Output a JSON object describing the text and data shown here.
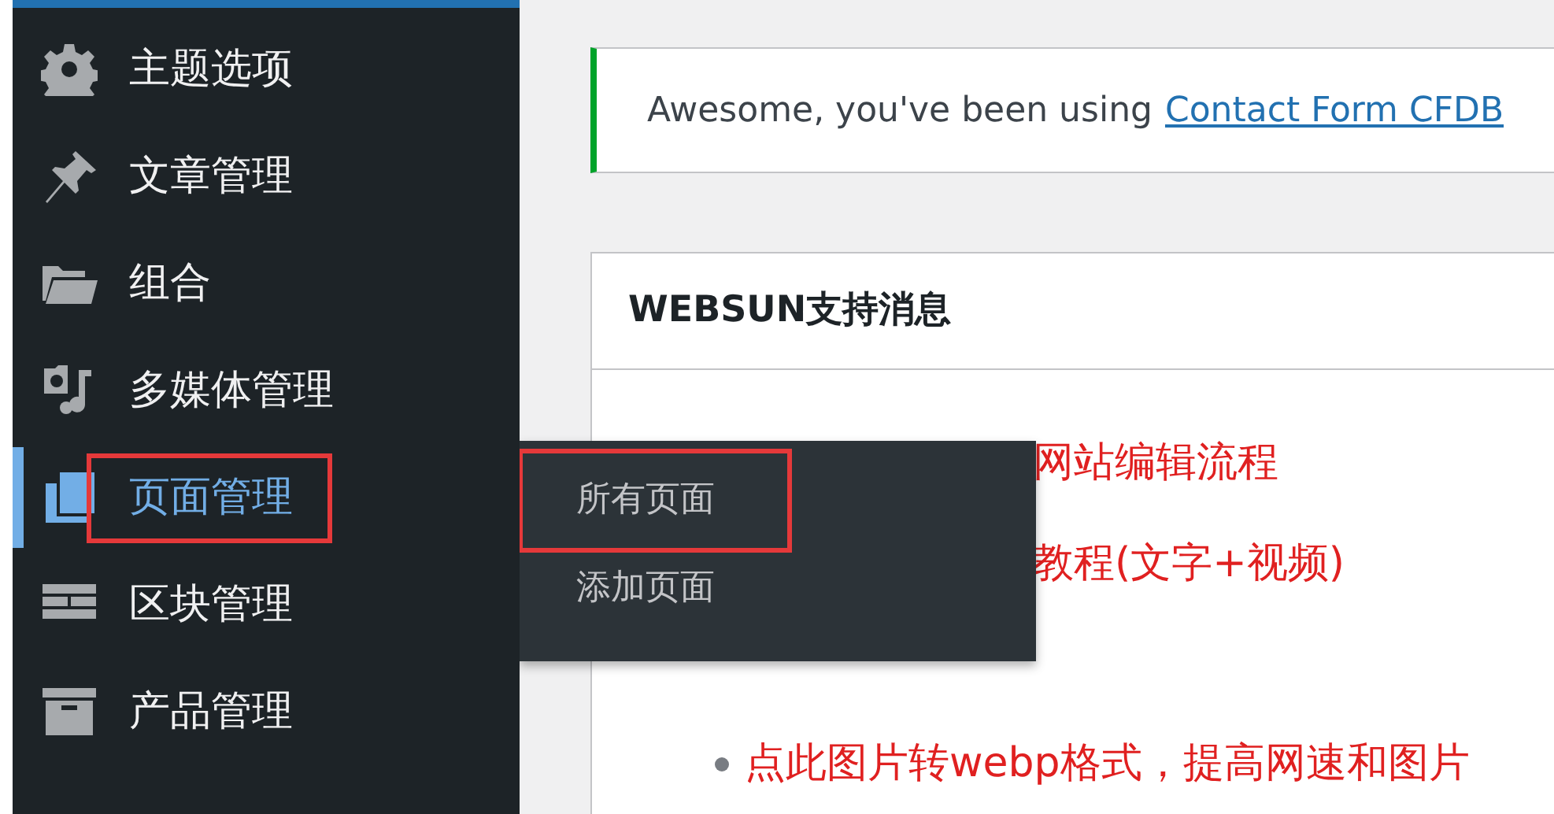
{
  "sidebar": {
    "items": [
      {
        "label": "主题选项",
        "kind": "gear",
        "selected": false,
        "highlighted": false
      },
      {
        "label": "文章管理",
        "kind": "pin",
        "selected": false,
        "highlighted": false
      },
      {
        "label": "组合",
        "kind": "folder",
        "selected": false,
        "highlighted": false
      },
      {
        "label": "多媒体管理",
        "kind": "media",
        "selected": false,
        "highlighted": false
      },
      {
        "label": "页面管理",
        "kind": "pages",
        "selected": true,
        "highlighted": true
      },
      {
        "label": "区块管理",
        "kind": "blocks",
        "selected": false,
        "highlighted": false
      },
      {
        "label": "产品管理",
        "kind": "box",
        "selected": false,
        "highlighted": false
      }
    ]
  },
  "flyout": {
    "items": [
      {
        "label": "所有页面",
        "selected": false,
        "highlighted": true
      },
      {
        "label": "添加页面",
        "selected": false,
        "highlighted": false
      }
    ]
  },
  "notice": {
    "text": "Awesome, you've been using",
    "link": "Contact Form CFDB"
  },
  "card": {
    "title": "WEBSUN支持消息",
    "items": [
      {
        "text": "网站编辑流程",
        "kind": "covered"
      },
      {
        "text": "教程(文字+视频)",
        "kind": "covered"
      },
      {
        "text": "点此图片转webp格式，提高网速和图片",
        "kind": "bullet"
      }
    ]
  }
}
